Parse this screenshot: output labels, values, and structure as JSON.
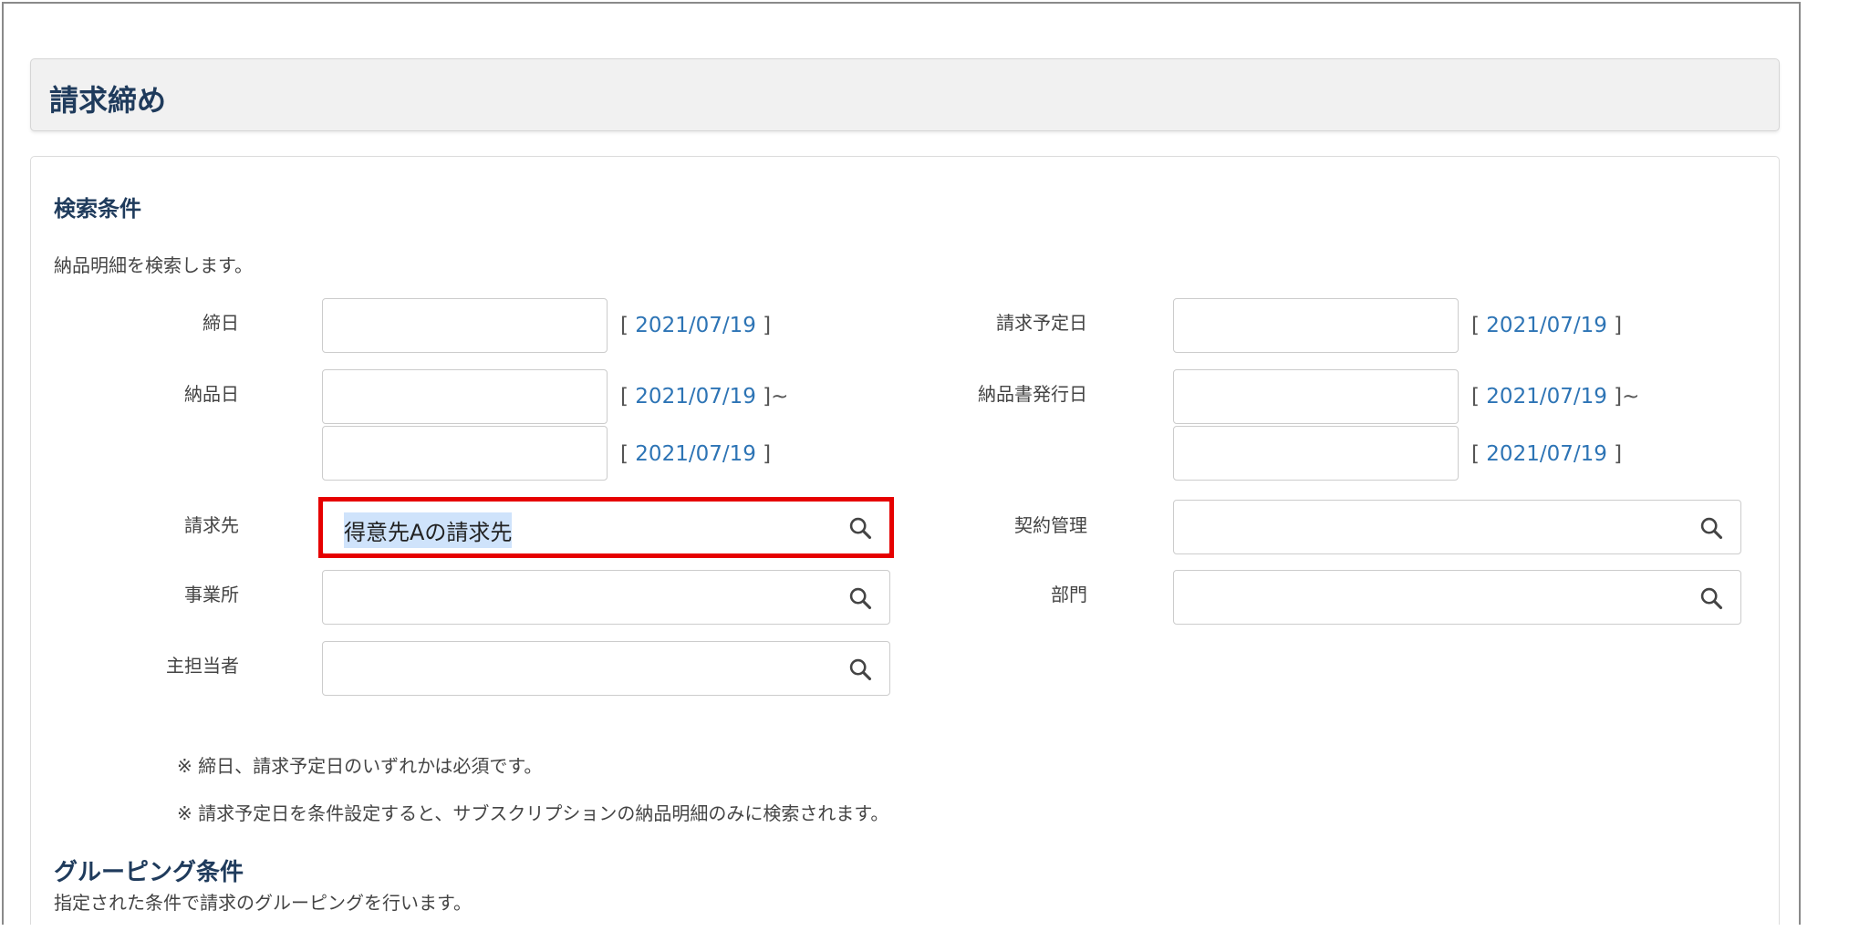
{
  "page": {
    "title": "請求締め"
  },
  "search": {
    "title": "検索条件",
    "description": "納品明細を検索します。",
    "fields": {
      "shimebi": {
        "label": "締日",
        "date_link": "2021/07/19"
      },
      "seikyu_yotei": {
        "label": "請求予定日",
        "date_link": "2021/07/19"
      },
      "nohinbi": {
        "label": "納品日",
        "date_from": "2021/07/19",
        "date_to": "2021/07/19",
        "range_sep": "~"
      },
      "nohinsho_hakko": {
        "label": "納品書発行日",
        "date_from": "2021/07/19",
        "date_to": "2021/07/19",
        "range_sep": "~"
      },
      "seikyusaki": {
        "label": "請求先",
        "value": "得意先Aの請求先"
      },
      "keiyaku": {
        "label": "契約管理",
        "value": ""
      },
      "jigyosho": {
        "label": "事業所",
        "value": ""
      },
      "bumon": {
        "label": "部門",
        "value": ""
      },
      "shutanto": {
        "label": "主担当者",
        "value": ""
      }
    },
    "notes": [
      "※ 締日、請求予定日のいずれかは必須です。",
      "※ 請求予定日を条件設定すると、サブスクリプションの納品明細のみに検索されます。"
    ]
  },
  "grouping": {
    "title": "グルーピング条件",
    "description": "指定された条件で請求のグルーピングを行います。"
  },
  "colors": {
    "link": "#2d74b5",
    "title": "#1f3b5c",
    "highlight": "#e60000",
    "selection": "#cfe3fb"
  }
}
